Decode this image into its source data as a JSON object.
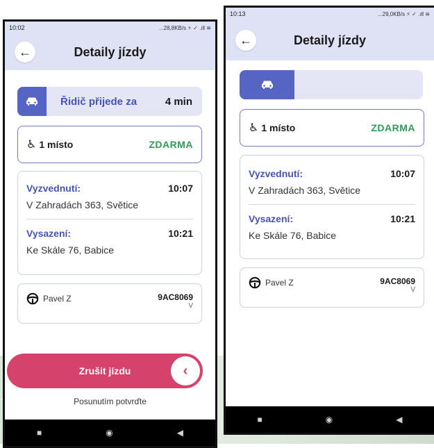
{
  "screens": [
    {
      "status_time": "10:02",
      "status_right": "...28,8KB/s ⚡ ✓ .ıll ≋",
      "title": "Detaily jízdy",
      "eta_label": "Řidič přijede za",
      "eta_value": "4 min",
      "seat_label": "1 místo",
      "price": "ZDARMA",
      "pickup_label": "Vyzvednutí:",
      "pickup_time": "10:07",
      "pickup_address": "V Zahradách 363, Světice",
      "dropoff_label": "Vysazení:",
      "dropoff_time": "10:21",
      "dropoff_address": "Ke Skále 76, Babice",
      "driver_name": "Pavel Z",
      "vehicle_plate": "9AC8069",
      "vehicle_suffix": "V",
      "cancel_label": "Zrušit jízdu",
      "cancel_hint": "Posunutím potvrďte"
    },
    {
      "status_time": "10:13",
      "status_right": "...29,0KB/s ⚡ ✓ .ıll ≋",
      "title": "Detaily jízdy",
      "eta_progress": 0.3,
      "seat_label": "1 místo",
      "price": "ZDARMA",
      "pickup_label": "Vyzvednutí:",
      "pickup_time": "10:07",
      "pickup_address": "V Zahradách 363, Světice",
      "dropoff_label": "Vysazení:",
      "dropoff_time": "10:21",
      "dropoff_address": "Ke Skále 76, Babice",
      "driver_name": "Pavel Z",
      "vehicle_plate": "9AC8069",
      "vehicle_suffix": "V"
    }
  ],
  "icons": {
    "back": "arrow-left-icon",
    "car": "car-icon",
    "seat": "accessible-seat-icon",
    "steering": "steering-wheel-icon",
    "cancel_knob": "chevron-left-icon"
  },
  "colors": {
    "accent": "#5664c3",
    "header_bg": "#dfe2f5",
    "price_green": "#2e9b58",
    "cancel_red": "#d5426b"
  },
  "navbar": {
    "back": "◀",
    "home": "◉",
    "recents": "■"
  }
}
